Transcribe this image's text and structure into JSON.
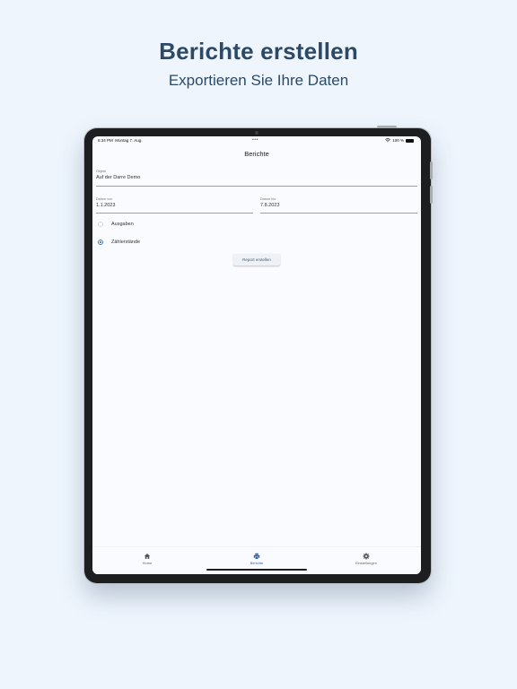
{
  "headline": "Berichte erstellen",
  "subline": "Exportieren Sie Ihre Daten",
  "statusbar": {
    "time": "6:34 PM",
    "date": "Montag 7. Aug.",
    "battery": "100 %",
    "dots": "•••"
  },
  "page_title": "Berichte",
  "form": {
    "object_label": "Objekt",
    "object_value": "Auf der Darre Demo",
    "date_from_label": "Datum von",
    "date_from_value": "1.1.2023",
    "date_to_label": "Datum bis",
    "date_to_value": "7.8.2023",
    "options": [
      {
        "label": "Ausgaben",
        "selected": false
      },
      {
        "label": "Zählerstände",
        "selected": true
      }
    ],
    "submit_label": "Report erstellen"
  },
  "tabs": [
    {
      "label": "Home",
      "icon": "home-icon",
      "active": false
    },
    {
      "label": "Berichte",
      "icon": "printer-icon",
      "active": true
    },
    {
      "label": "Einstellungen",
      "icon": "gear-icon",
      "active": false
    }
  ],
  "colors": {
    "background": "#eef5fd",
    "headline": "#2c4a66",
    "accent": "#2f66a4"
  }
}
